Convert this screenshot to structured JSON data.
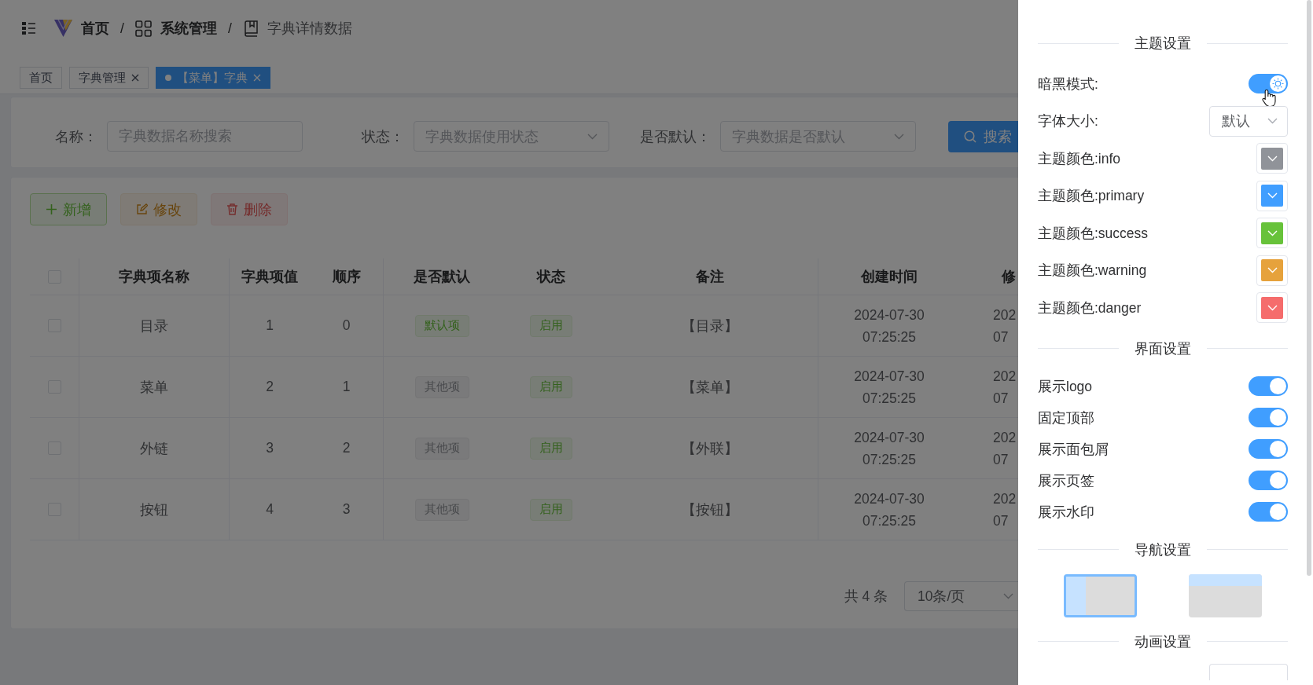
{
  "breadcrumb": [
    {
      "kind": "home",
      "label": "首页",
      "current": false
    },
    {
      "kind": "module",
      "label": "系统管理",
      "current": false,
      "separator": "/"
    },
    {
      "kind": "page",
      "label": "字典详情数据",
      "current": true,
      "separator": "/"
    }
  ],
  "tabs": [
    {
      "label": "首页",
      "selected": false,
      "closable": false
    },
    {
      "label": "字典管理",
      "selected": false,
      "closable": true
    },
    {
      "label": "【菜单】字典",
      "selected": true,
      "closable": true
    }
  ],
  "filters": [
    {
      "kind": "input",
      "label": "名称：",
      "placeholder": "字典数据名称搜索"
    },
    {
      "kind": "select",
      "label": "状态：",
      "placeholder": "字典数据使用状态"
    },
    {
      "kind": "select",
      "label": "是否默认：",
      "placeholder": "字典数据是否默认"
    }
  ],
  "search_button": "搜索",
  "toolbar": [
    {
      "kind": "add",
      "label": "新增",
      "disabled": false
    },
    {
      "kind": "edit",
      "label": "修改",
      "disabled": true
    },
    {
      "kind": "delete",
      "label": "删除",
      "disabled": true
    }
  ],
  "table": {
    "all_checked": false,
    "columns": [
      "字典项名称",
      "字典项值",
      "顺序",
      "是否默认",
      "状态",
      "备注",
      "创建时间",
      "修"
    ],
    "rows": [
      {
        "checked": false,
        "name": "目录",
        "value": "1",
        "order": "0",
        "default_tag": {
          "kind": "success",
          "label": "默认项"
        },
        "status_tag": {
          "kind": "success",
          "label": "启用"
        },
        "remark": "【目录】",
        "created": "2024-07-30 07:25:25",
        "column_9": "202 07"
      },
      {
        "checked": false,
        "name": "菜单",
        "value": "2",
        "order": "1",
        "default_tag": {
          "kind": "info",
          "label": "其他项"
        },
        "status_tag": {
          "kind": "success",
          "label": "启用"
        },
        "remark": "【菜单】",
        "created": "2024-07-30 07:25:25",
        "column_9": "202 07"
      },
      {
        "checked": false,
        "name": "外链",
        "value": "3",
        "order": "2",
        "default_tag": {
          "kind": "info",
          "label": "其他项"
        },
        "status_tag": {
          "kind": "success",
          "label": "启用"
        },
        "remark": "【外联】",
        "created": "2024-07-30 07:25:25",
        "column_9": "202 07"
      },
      {
        "checked": false,
        "name": "按钮",
        "value": "4",
        "order": "3",
        "default_tag": {
          "kind": "info",
          "label": "其他项"
        },
        "status_tag": {
          "kind": "success",
          "label": "启用"
        },
        "remark": "【按钮】",
        "created": "2024-07-30 07:25:25",
        "column_9": "202 07"
      }
    ]
  },
  "pagination": {
    "total": "共 4 条",
    "page_size": "10条/页"
  },
  "settings": {
    "sections": [
      {
        "title": "主题设置",
        "rows": [
          {
            "kind": "mode",
            "label": "暗黑模式:",
            "on": true
          },
          {
            "kind": "select",
            "label": "字体大小:",
            "value": "默认"
          },
          {
            "kind": "color",
            "label": "主题颜色:info",
            "color": "#909399"
          },
          {
            "kind": "color",
            "label": "主题颜色:primary",
            "color": "#409eff"
          },
          {
            "kind": "color",
            "label": "主题颜色:success",
            "color": "#67c23a"
          },
          {
            "kind": "color",
            "label": "主题颜色:warning",
            "color": "#e6a23c"
          },
          {
            "kind": "color",
            "label": "主题颜色:danger",
            "color": "#f56c6c"
          }
        ]
      },
      {
        "title": "界面设置",
        "rows": [
          {
            "kind": "switch",
            "label": "展示logo",
            "on": true
          },
          {
            "kind": "switch",
            "label": "固定顶部",
            "on": true
          },
          {
            "kind": "switch",
            "label": "展示面包屑",
            "on": true
          },
          {
            "kind": "switch",
            "label": "展示页签",
            "on": true
          },
          {
            "kind": "switch",
            "label": "展示水印",
            "on": true
          }
        ]
      },
      {
        "title": "导航设置",
        "layouts": [
          {
            "kind": "side",
            "selected": true
          },
          {
            "kind": "top",
            "selected": false
          }
        ]
      },
      {
        "title": "动画设置",
        "rows": [
          {
            "kind": "select"
          }
        ]
      }
    ]
  }
}
